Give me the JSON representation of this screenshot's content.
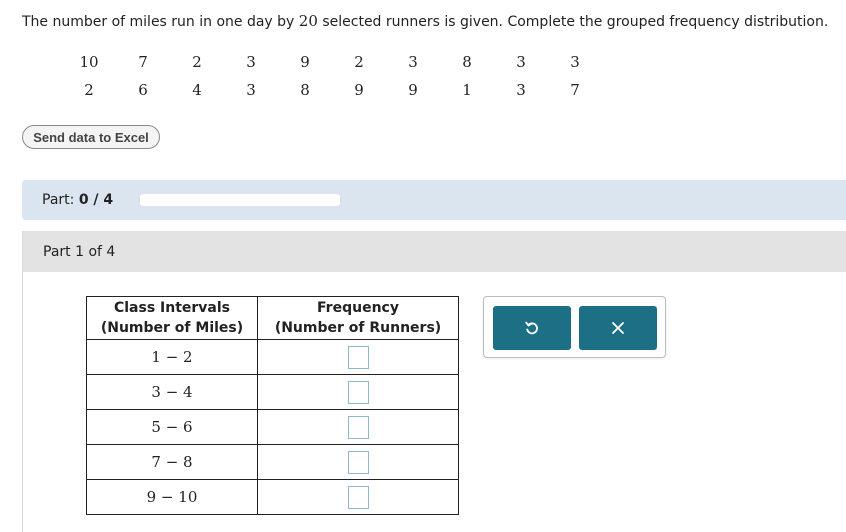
{
  "prompt": {
    "before": "The number of miles run in one day by ",
    "count": "20",
    "after": " selected runners is given. Complete the grouped frequency distribution."
  },
  "data_values": [
    [
      "10",
      "7",
      "2",
      "3",
      "9",
      "2",
      "3",
      "8",
      "3",
      "3"
    ],
    [
      "2",
      "6",
      "4",
      "3",
      "8",
      "9",
      "9",
      "1",
      "3",
      "7"
    ]
  ],
  "excel_button": {
    "label": "Send data to Excel"
  },
  "progress": {
    "label": "Part:",
    "value": "0 / 4",
    "fraction": 0
  },
  "section": {
    "title": "Part 1 of 4"
  },
  "table": {
    "headers": [
      {
        "line1": "Class Intervals",
        "line2": "(Number of Miles)"
      },
      {
        "line1": "Frequency",
        "line2": "(Number of Runners)"
      }
    ],
    "rows": [
      {
        "interval": "1 − 2",
        "frequency": ""
      },
      {
        "interval": "3 − 4",
        "frequency": ""
      },
      {
        "interval": "5 − 6",
        "frequency": ""
      },
      {
        "interval": "7 − 8",
        "frequency": ""
      },
      {
        "interval": "9 − 10",
        "frequency": ""
      }
    ]
  },
  "tools": {
    "undo_icon": "undo-icon",
    "clear_icon": "close-icon"
  },
  "colors": {
    "accent": "#1d6f85",
    "part_bar": "#dbe5ef",
    "section_head": "#e3e3e3",
    "input_border": "#8fb8cb"
  }
}
